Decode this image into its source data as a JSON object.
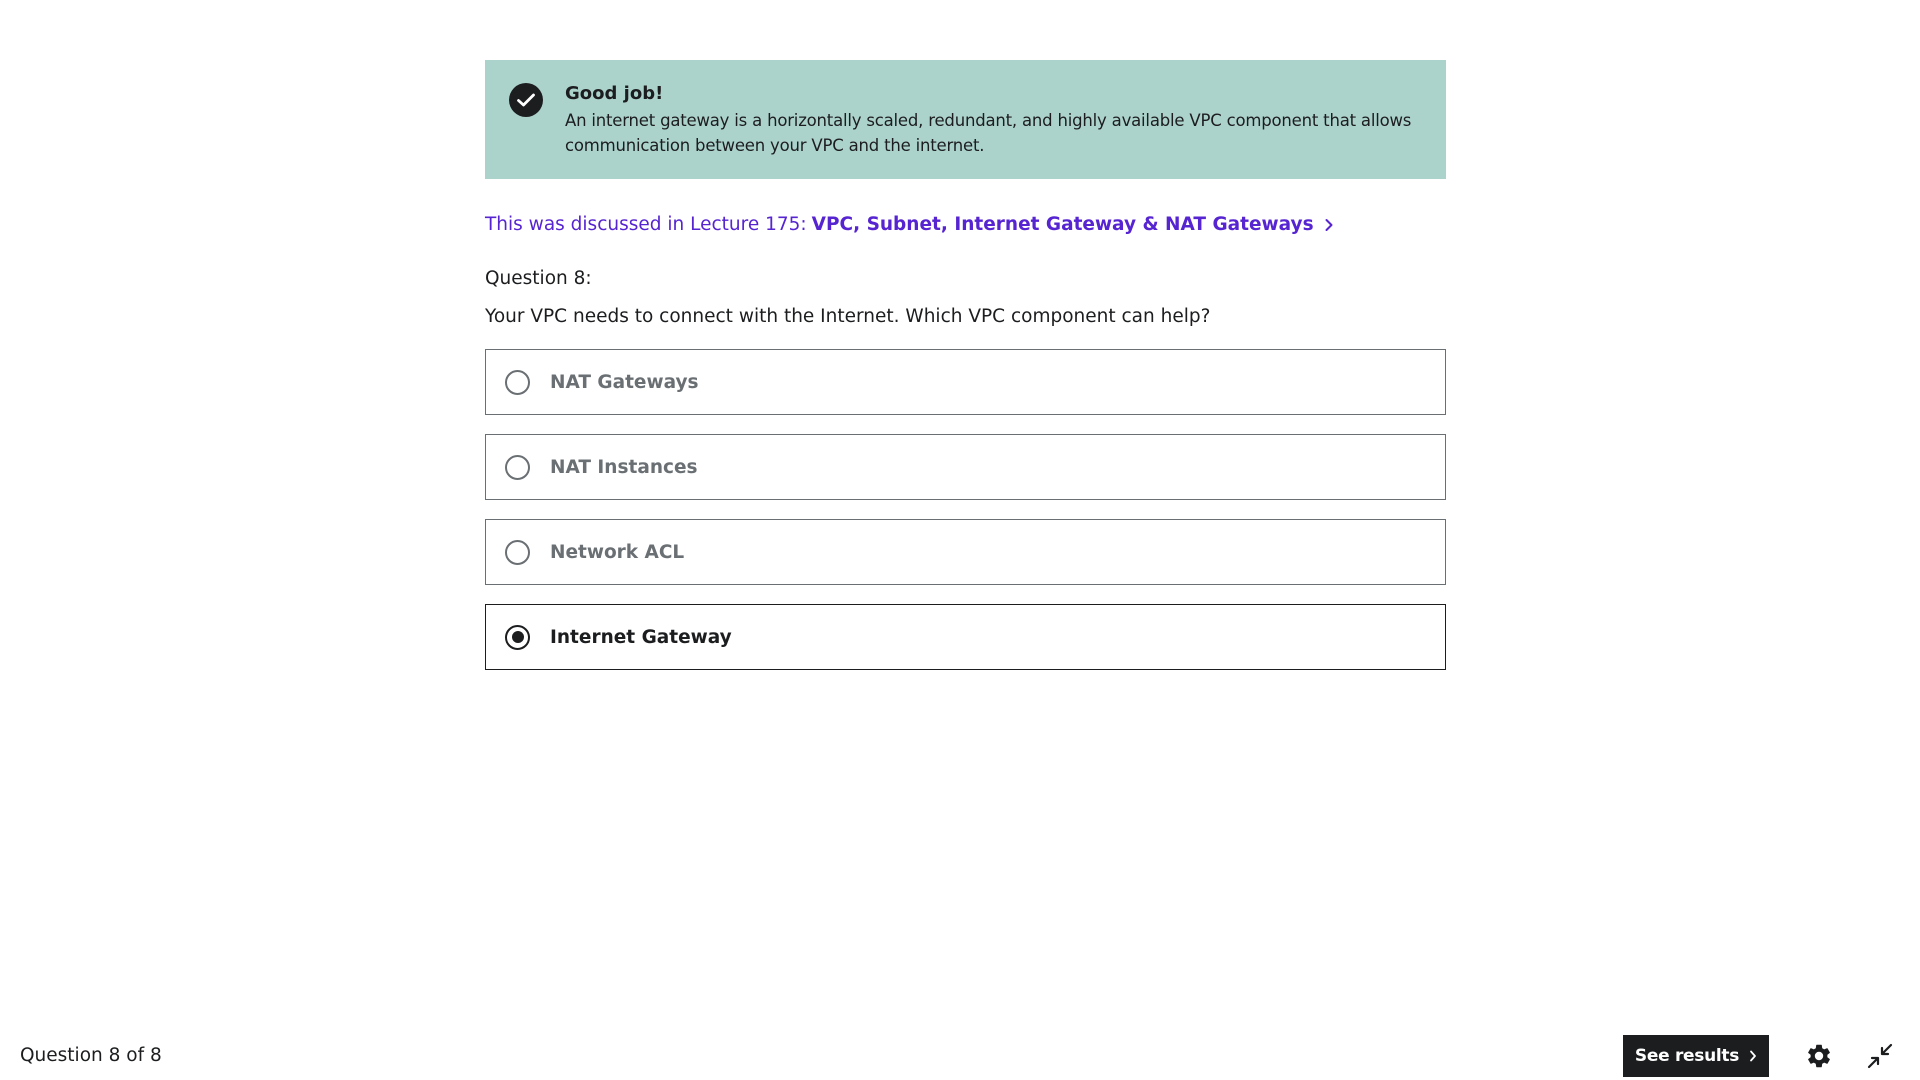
{
  "feedback": {
    "title": "Good job!",
    "body": "An internet gateway is a horizontally scaled, redundant, and highly available VPC component that allows communication between your VPC and the internet.",
    "icon": "check-circle-icon",
    "background": "#acd2cc"
  },
  "lecture_link": {
    "prefix": "This was discussed in Lecture 175:",
    "title": "VPC, Subnet, Internet Gateway & NAT Gateways",
    "color": "#5624d0"
  },
  "question": {
    "label": "Question 8:",
    "text": "Your VPC needs to connect with the Internet. Which VPC component can help?",
    "answers": [
      {
        "label": "NAT Gateways",
        "selected": false
      },
      {
        "label": "NAT Instances",
        "selected": false
      },
      {
        "label": "Network ACL",
        "selected": false
      },
      {
        "label": "Internet Gateway",
        "selected": true
      }
    ]
  },
  "footer": {
    "progress": "Question 8 of 8",
    "see_results_label": "See results",
    "icons": [
      "gear-icon",
      "collapse-icon"
    ]
  }
}
